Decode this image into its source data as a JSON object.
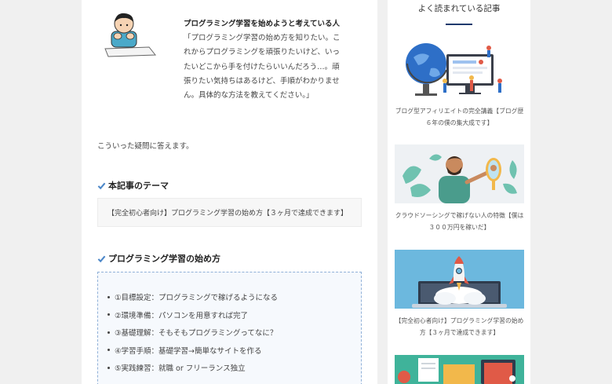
{
  "question": {
    "strong": "プログラミング学習を始めようと考えている人",
    "text": "「プログラミング学習の始め方を知りたい。これからプログラミングを頑張りたいけど、いったいどこから手を付けたらいいんだろう…。頑張りたい気持ちはあるけど、手順がわかりません。具体的な方法を教えてください。」"
  },
  "intro": "こういった疑問に答えます。",
  "section_theme": {
    "heading": "本記事のテーマ",
    "box": "【完全初心者向け】プログラミング学習の始め方【３ヶ月で達成できます】"
  },
  "section_steps": {
    "heading": "プログラミング学習の始め方",
    "items": [
      "①目標設定：プログラミングで稼げるようになる",
      "②環境準備：パソコンを用意すれば完了",
      "③基礎理解：そもそもプログラミングってなに？",
      "④学習手順：基礎学習→簡単なサイトを作る",
      "⑤実践練習：就職 or フリーランス独立"
    ]
  },
  "sidebar": {
    "title": "よく読まれている記事",
    "articles": [
      {
        "caption": "ブログ型アフィリエイトの完全講義【ブログ歴６年の僕の集大成です】"
      },
      {
        "caption": "クラウドソーシングで稼げない人の特徴【僕は３００万円を稼いだ】"
      },
      {
        "caption": "【完全初心者向け】プログラミング学習の始め方【３ヶ月で達成できます】"
      }
    ]
  },
  "colors": {
    "accent": "#1e3a6d",
    "check": "#4a86c8",
    "box_border": "#8fb0d8"
  }
}
